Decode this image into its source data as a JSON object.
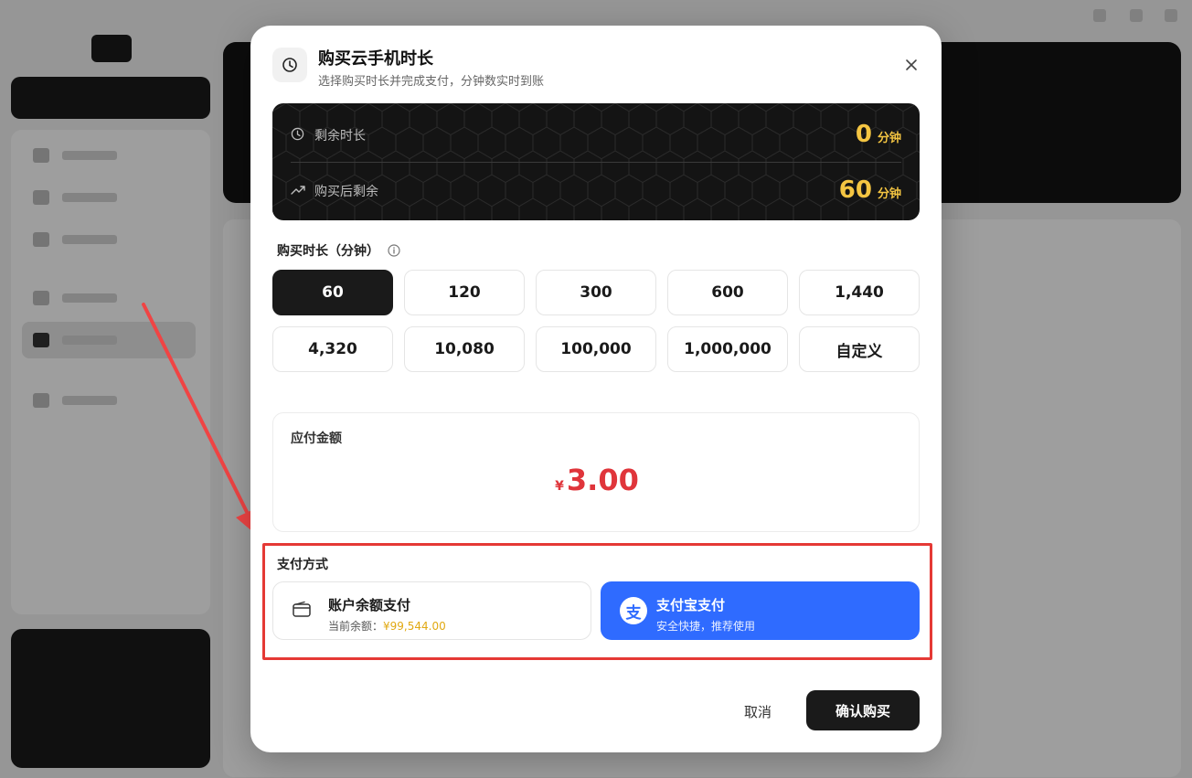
{
  "modal": {
    "title": "购买云手机时长",
    "subtitle": "选择购买时长并完成支付，分钟数实时到账",
    "balance": {
      "remaining_label": "剩余时长",
      "remaining_value": "0",
      "after_label": "购买后剩余",
      "after_value": "60",
      "unit": "分钟",
      "accent_color": "#f4c542"
    },
    "duration": {
      "label": "购买时长（分钟）",
      "options": [
        "60",
        "120",
        "300",
        "600",
        "1,440",
        "4,320",
        "10,080",
        "100,000",
        "1,000,000",
        "自定义"
      ],
      "selected": "60"
    },
    "amount": {
      "label": "应付金额",
      "currency": "¥",
      "value": "3.00",
      "color": "#e0353b"
    },
    "payment": {
      "label": "支付方式",
      "options": [
        {
          "title": "账户余额支付",
          "sub_prefix": "当前余额：",
          "sub_value": "¥99,544.00",
          "icon": "wallet-icon"
        },
        {
          "title": "支付宝支付",
          "sub": "安全快捷，推荐使用",
          "icon": "alipay-icon",
          "icon_glyph": "支"
        }
      ],
      "selected": "支付宝支付",
      "accent_color": "#2f6bff"
    },
    "footer": {
      "cancel": "取消",
      "confirm": "确认购买"
    },
    "icons": {
      "header": "clock-icon",
      "close": "close-icon",
      "info": "info-icon",
      "remaining": "clock-icon",
      "after": "trend-up-icon"
    }
  },
  "annotation": {
    "highlight_color": "#e53935"
  }
}
